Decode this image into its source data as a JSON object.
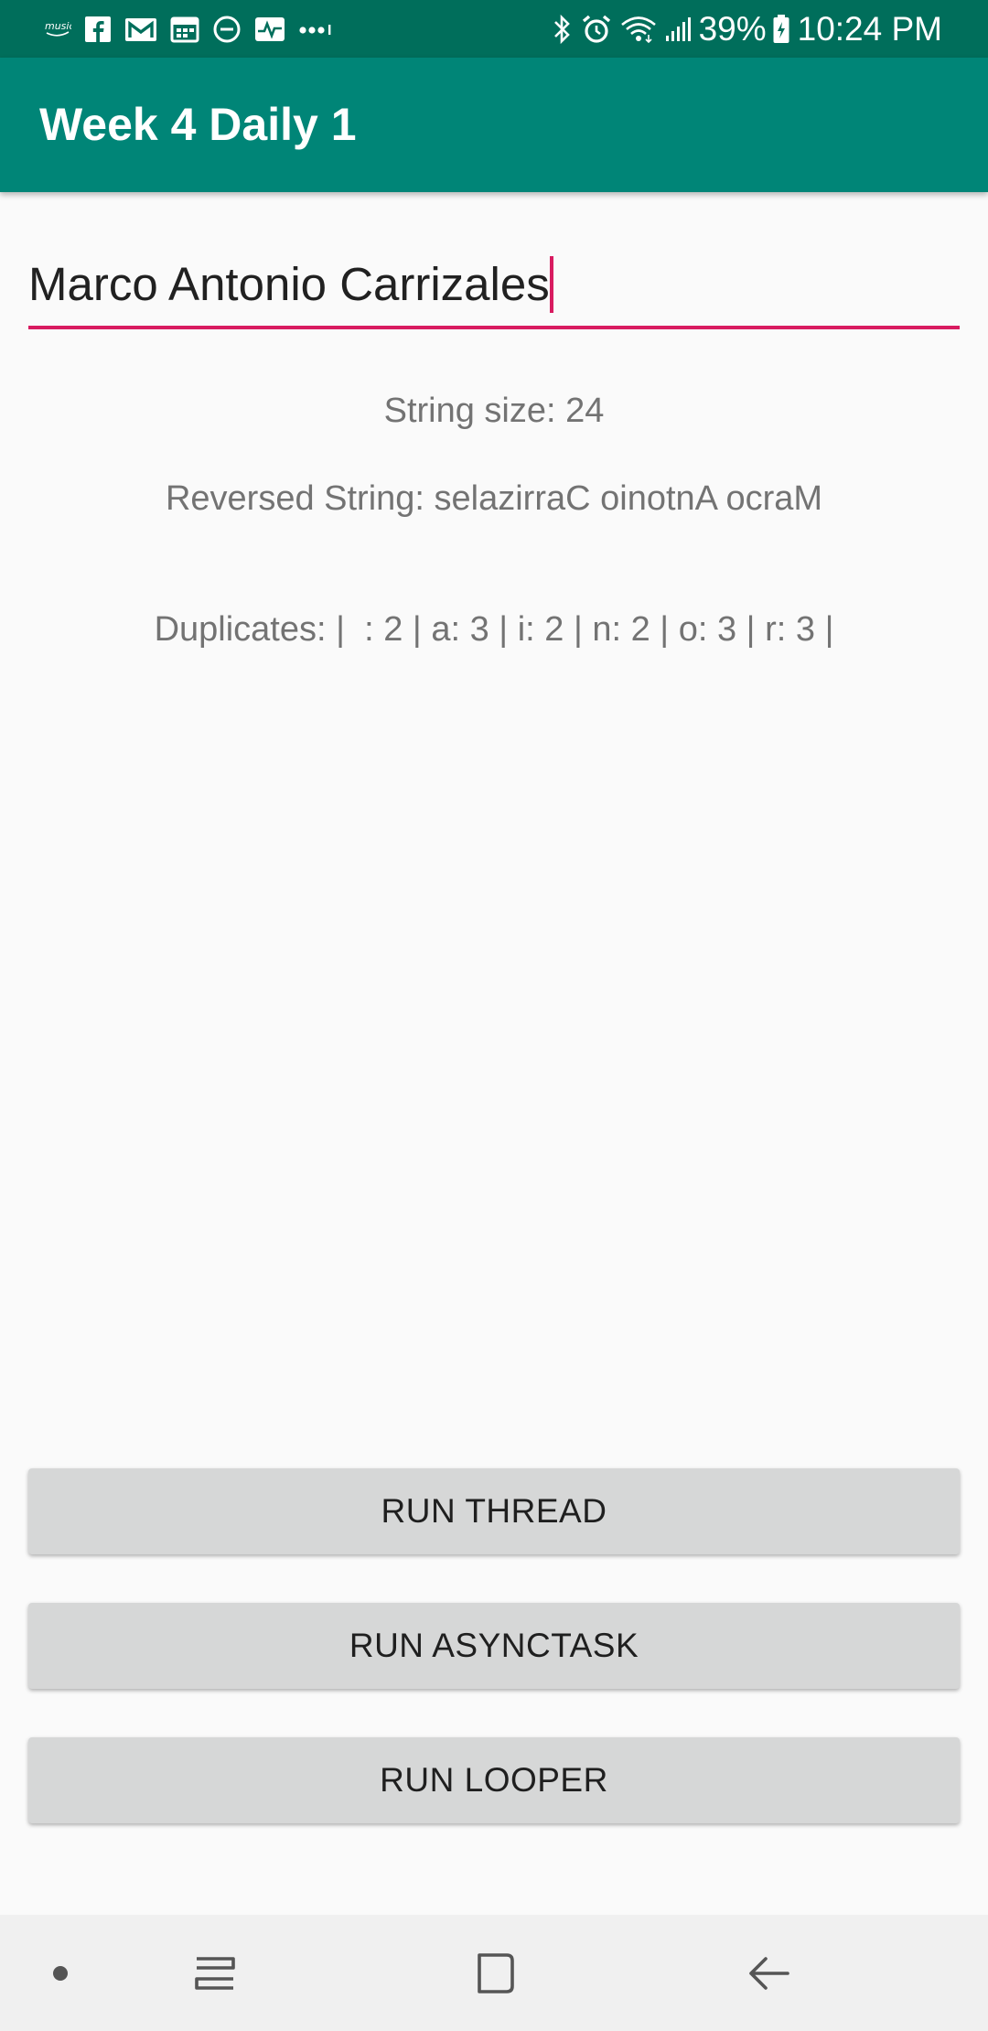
{
  "status_bar": {
    "music_label": "music",
    "battery_percent": "39%",
    "time": "10:24 PM",
    "icons_left": [
      "amazon-music-icon",
      "facebook-icon",
      "gmail-icon",
      "calendar-icon",
      "do-not-disturb-icon",
      "activity-icon",
      "more-notifications-icon"
    ],
    "icons_right": [
      "bluetooth-icon",
      "alarm-icon",
      "wifi-icon",
      "signal-icon",
      "battery-icon"
    ]
  },
  "app_bar": {
    "title": "Week 4 Daily 1"
  },
  "input": {
    "value": "Marco Antonio Carrizales"
  },
  "results": {
    "string_size": "String size: 24",
    "reversed": "Reversed String: selazirraC oinotnA ocraM",
    "duplicates": "Duplicates: |  : 2 | a: 3 | i: 2 | n: 2 | o: 3 | r: 3 |"
  },
  "buttons": {
    "run_thread": "RUN THREAD",
    "run_asynctask": "RUN ASYNCTASK",
    "run_looper": "RUN LOOPER"
  },
  "nav_bar": {
    "icons": [
      "nav-dot-icon",
      "recent-apps-icon",
      "home-icon",
      "back-icon"
    ]
  },
  "colors": {
    "status_bar": "#006e5b",
    "app_bar": "#008577",
    "accent": "#d81b60",
    "button": "#d6d7d7",
    "background": "#fafafa"
  }
}
